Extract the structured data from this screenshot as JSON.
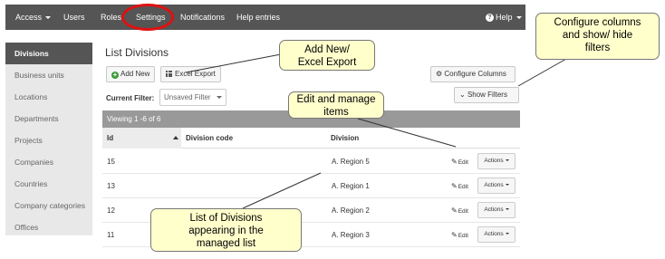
{
  "navbar": {
    "items": [
      "Access",
      "Users",
      "Roles",
      "Settings",
      "Notifications",
      "Help entries"
    ],
    "help_label": "Help",
    "bg_color": "#555555"
  },
  "sidebar": {
    "items": [
      {
        "label": "Divisions",
        "active": true
      },
      {
        "label": "Business units"
      },
      {
        "label": "Locations"
      },
      {
        "label": "Departments"
      },
      {
        "label": "Projects"
      },
      {
        "label": "Companies"
      },
      {
        "label": "Countries"
      },
      {
        "label": "Company categories"
      },
      {
        "label": "Offices"
      }
    ]
  },
  "main": {
    "title": "List Divisions",
    "add_new_label": "Add New",
    "excel_export_label": "Excel Export",
    "configure_columns_label": "Configure Columns",
    "show_filters_label": "Show Filters",
    "filter_label": "Current Filter:",
    "filter_value": "Unsaved Filter",
    "viewing_text": "Viewing 1 -6 of 6",
    "columns": [
      "Id",
      "Division code",
      "Division"
    ],
    "rows": [
      {
        "id": "15",
        "code": "",
        "division": "A. Region 5"
      },
      {
        "id": "13",
        "code": "",
        "division": "A. Region 1"
      },
      {
        "id": "12",
        "code": "",
        "division": "A. Region 2"
      },
      {
        "id": "11",
        "code": "",
        "division": "A. Region 3"
      }
    ],
    "edit_label": "Edit",
    "actions_label": "Actions"
  },
  "callouts": {
    "add_new": "Add New/\nExcel Export",
    "configure": "Configure  columns\nand  show/ hide\nfilters",
    "edit_manage": "Edit and manage\nitems",
    "list": "List of Divisions\nappearing  in the\nmanaged list"
  },
  "colors": {
    "highlight": "#e01010",
    "callout_bg": "#ffffcc",
    "view_bar": "#999999"
  }
}
